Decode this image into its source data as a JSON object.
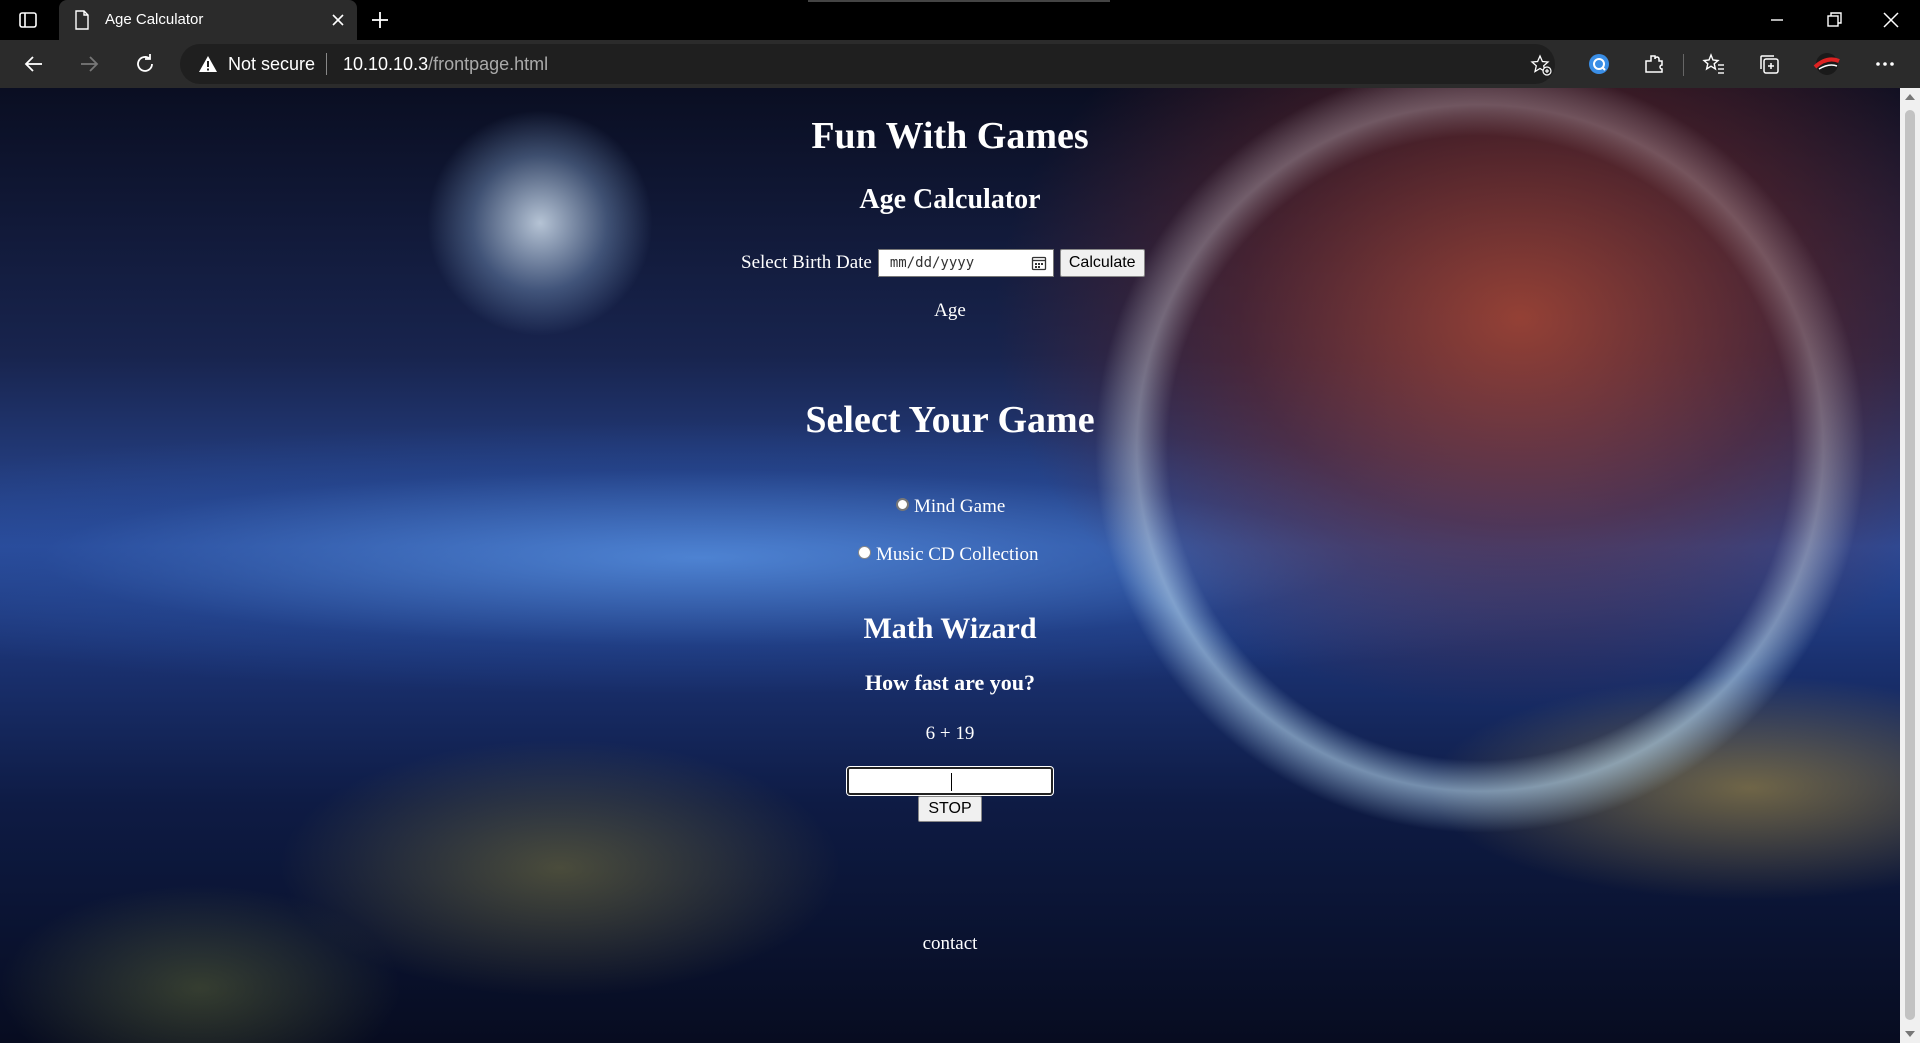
{
  "browser": {
    "tab_title": "Age Calculator",
    "security_label": "Not secure",
    "url_host": "10.10.10.3",
    "url_path": "/frontpage.html"
  },
  "page": {
    "site_title": "Fun With Games",
    "age_calculator": {
      "heading": "Age Calculator",
      "birth_label": "Select Birth Date",
      "date_placeholder": "mm/dd/yyyy",
      "calculate_label": "Calculate",
      "age_label": "Age"
    },
    "games": {
      "heading": "Select Your Game",
      "options": [
        {
          "label": "Mind Game",
          "selected": false
        },
        {
          "label": "Music CD Collection",
          "selected": false
        }
      ]
    },
    "math_wizard": {
      "heading": "Math Wizard",
      "question": "How fast are you?",
      "problem": "6 + 19",
      "answer_value": "",
      "stop_label": "STOP"
    },
    "contact_label": "contact"
  },
  "colors": {
    "chrome_bg": "#000000",
    "toolbar_bg": "#2b2b2b",
    "text": "#ffffff"
  }
}
